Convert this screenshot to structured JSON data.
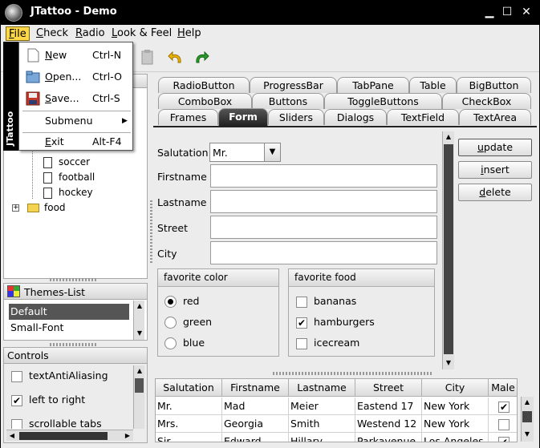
{
  "window": {
    "title": "JTattoo - Demo",
    "minimize": "▁",
    "maximize": "☐",
    "close": "✕"
  },
  "menubar": {
    "items": [
      {
        "mnemonic": "F",
        "rest": "ile"
      },
      {
        "mnemonic": "C",
        "rest": "heck"
      },
      {
        "mnemonic": "R",
        "rest": "adio"
      },
      {
        "mnemonic": "L",
        "rest": "ook & Feel"
      },
      {
        "mnemonic": "H",
        "rest": "elp"
      }
    ]
  },
  "file_menu": {
    "side_label": "JTattoo",
    "items": [
      {
        "mnemonic": "N",
        "rest": "ew",
        "shortcut": "Ctrl-N",
        "icon": "new-document-icon"
      },
      {
        "mnemonic": "O",
        "rest": "pen...",
        "shortcut": "Ctrl-O",
        "icon": "open-folder-icon"
      },
      {
        "mnemonic": "S",
        "rest": "ave...",
        "shortcut": "Ctrl-S",
        "icon": "save-disk-icon"
      },
      {
        "label": "Submenu",
        "arrow": "▶"
      },
      {
        "mnemonic": "E",
        "rest": "xit",
        "shortcut": "Alt-F4"
      }
    ]
  },
  "tree": {
    "items": [
      "soccer",
      "football",
      "hockey",
      "food"
    ]
  },
  "themes": {
    "title": "Themes-List",
    "items": [
      "Default",
      "Small-Font"
    ],
    "selected": "Default"
  },
  "controls": {
    "title": "Controls",
    "items": [
      {
        "label": "textAntiAliasing",
        "checked": false
      },
      {
        "label": "left to right",
        "checked": true
      },
      {
        "label": "scrollable tabs",
        "checked": false
      }
    ]
  },
  "tabs": {
    "row1": [
      "RadioButton",
      "ProgressBar",
      "TabPane",
      "Table",
      "BigButton"
    ],
    "row2": [
      "ComboBox",
      "Buttons",
      "ToggleButtons",
      "CheckBox"
    ],
    "row3": [
      "Frames",
      "Form",
      "Sliders",
      "Dialogs",
      "TextField",
      "TextArea"
    ],
    "selected": "Form"
  },
  "form": {
    "salutation_label": "Salutation",
    "salutation_value": "Mr.",
    "firstname_label": "Firstname",
    "lastname_label": "Lastname",
    "street_label": "Street",
    "city_label": "City",
    "buttons": [
      {
        "mnemonic": "u",
        "rest": "pdate"
      },
      {
        "mnemonic": "i",
        "rest": "nsert"
      },
      {
        "mnemonic": "d",
        "rest": "elete"
      }
    ],
    "color_group": {
      "title": "favorite color",
      "options": [
        "red",
        "green",
        "blue"
      ],
      "selected": "red"
    },
    "food_group": {
      "title": "favorite food",
      "options": [
        {
          "label": "bananas",
          "checked": false
        },
        {
          "label": "hamburgers",
          "checked": true
        },
        {
          "label": "icecream",
          "checked": false
        }
      ]
    }
  },
  "table": {
    "columns": [
      "Salutation",
      "Firstname",
      "Lastname",
      "Street",
      "City",
      "Male"
    ],
    "rows": [
      [
        "Mr.",
        "Mad",
        "Meier",
        "Eastend 17",
        "New York",
        true
      ],
      [
        "Mrs.",
        "Georgia",
        "Smith",
        "Westend 12",
        "New York",
        false
      ],
      [
        "Sir",
        "Edward",
        "Hillary",
        "Parkavenue",
        "Los Angeles",
        true
      ]
    ]
  },
  "colors": {
    "menu_highlight": "#ffd84a",
    "titlebar": "#000000",
    "selected_tab": "#2a2a2a",
    "toolbar_arrow": "#f0b400",
    "toolbar_redo": "#2a9a2a"
  }
}
